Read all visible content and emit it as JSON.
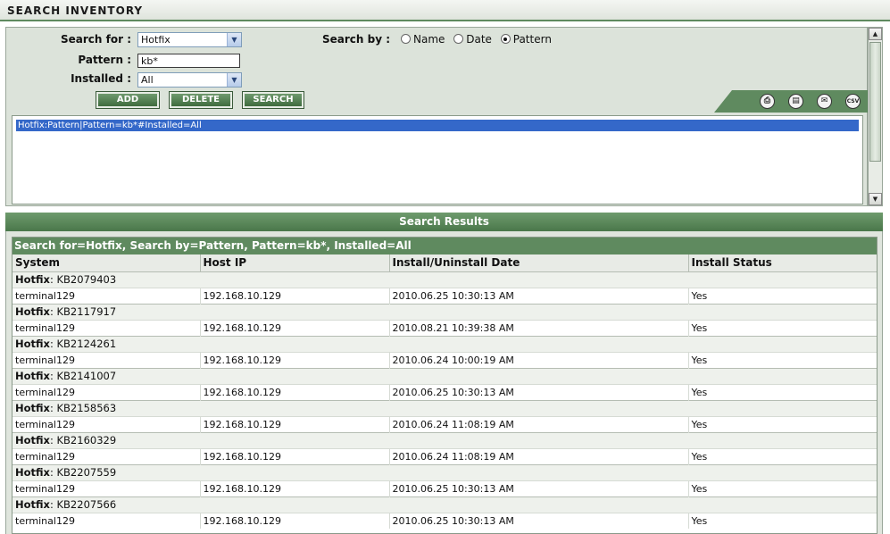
{
  "title": "SEARCH INVENTORY",
  "form": {
    "search_for_label": "Search for :",
    "search_for_value": "Hotfix",
    "pattern_label": "Pattern :",
    "pattern_value": "kb*",
    "installed_label": "Installed :",
    "installed_value": "All",
    "search_by_label": "Search by :",
    "search_by_options": [
      "Name",
      "Date",
      "Pattern"
    ],
    "search_by_selected": "Pattern",
    "buttons": {
      "add": "ADD",
      "delete": "DELETE",
      "search": "SEARCH"
    }
  },
  "toolbar_icons": [
    "print-icon",
    "pdf-icon",
    "email-icon",
    "csv-icon"
  ],
  "toolbar_icon_glyphs": {
    "csv": "CSV"
  },
  "criteria_list": [
    "Hotfix:Pattern|Pattern=kb*#Installed=All"
  ],
  "results": {
    "header": "Search Results",
    "summary": "Search for=Hotfix, Search by=Pattern, Pattern=kb*, Installed=All",
    "columns": [
      "System",
      "Host IP",
      "Install/Uninstall Date",
      "Install Status"
    ],
    "group_prefix": "Hotfix",
    "groups": [
      {
        "kb": "KB2079403",
        "system": "terminal129",
        "ip": "192.168.10.129",
        "date": "2010.06.25 10:30:13 AM",
        "status": "Yes"
      },
      {
        "kb": "KB2117917",
        "system": "terminal129",
        "ip": "192.168.10.129",
        "date": "2010.08.21 10:39:38 AM",
        "status": "Yes"
      },
      {
        "kb": "KB2124261",
        "system": "terminal129",
        "ip": "192.168.10.129",
        "date": "2010.06.24 10:00:19 AM",
        "status": "Yes"
      },
      {
        "kb": "KB2141007",
        "system": "terminal129",
        "ip": "192.168.10.129",
        "date": "2010.06.25 10:30:13 AM",
        "status": "Yes"
      },
      {
        "kb": "KB2158563",
        "system": "terminal129",
        "ip": "192.168.10.129",
        "date": "2010.06.24 11:08:19 AM",
        "status": "Yes"
      },
      {
        "kb": "KB2160329",
        "system": "terminal129",
        "ip": "192.168.10.129",
        "date": "2010.06.24 11:08:19 AM",
        "status": "Yes"
      },
      {
        "kb": "KB2207559",
        "system": "terminal129",
        "ip": "192.168.10.129",
        "date": "2010.06.25 10:30:13 AM",
        "status": "Yes"
      },
      {
        "kb": "KB2207566",
        "system": "terminal129",
        "ip": "192.168.10.129",
        "date": "2010.06.25 10:30:13 AM",
        "status": "Yes"
      }
    ]
  }
}
